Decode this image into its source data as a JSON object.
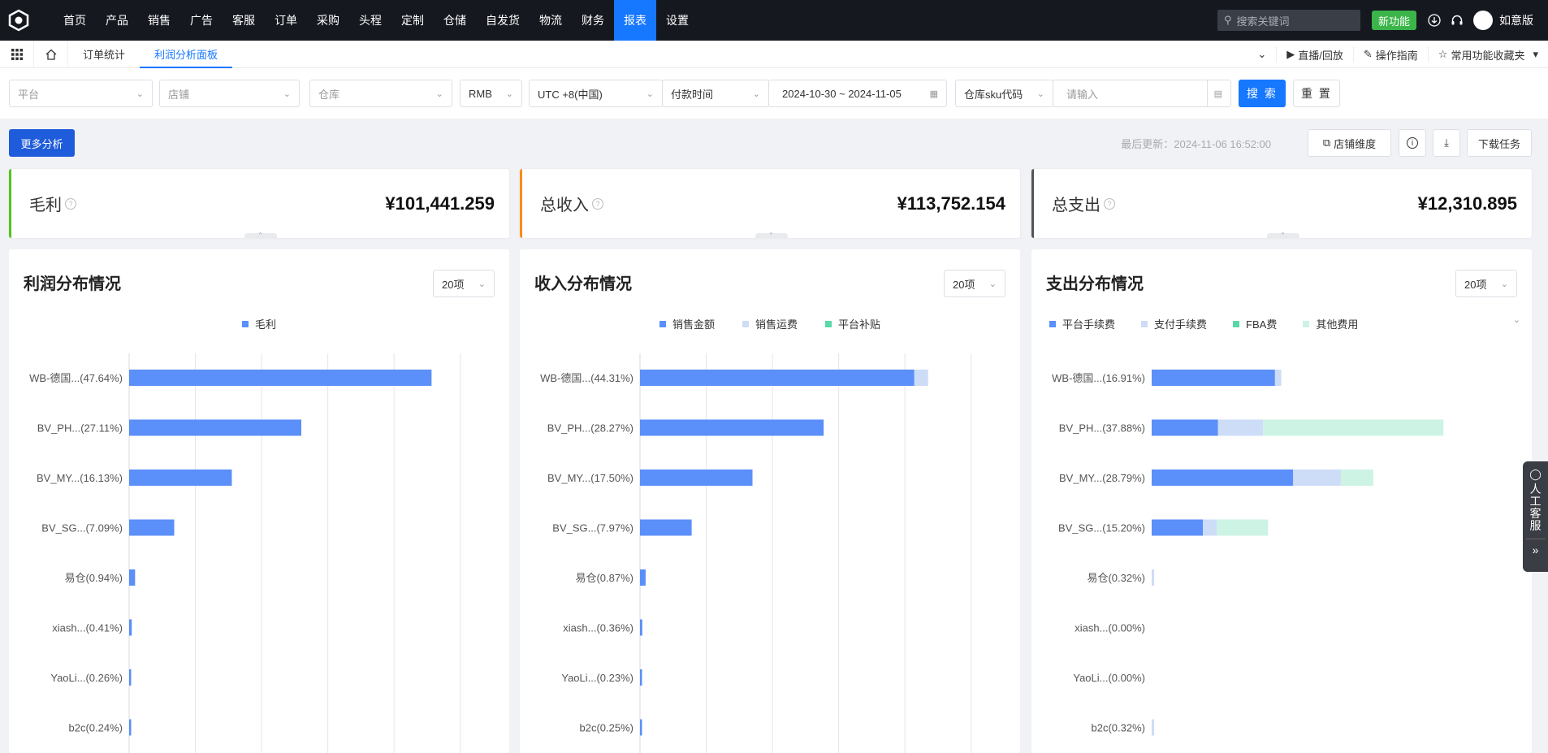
{
  "nav": {
    "items": [
      "首页",
      "产品",
      "销售",
      "广告",
      "客服",
      "订单",
      "采购",
      "头程",
      "定制",
      "仓储",
      "自发货",
      "物流",
      "财务",
      "报表",
      "设置"
    ],
    "active_index": 13,
    "search_placeholder": "搜索关键词",
    "new_feature": "新功能",
    "user_name": "如意版"
  },
  "tabs": {
    "items": [
      "订单统计",
      "利润分析面板"
    ],
    "active_index": 1,
    "right": [
      "直播/回放",
      "操作指南",
      "常用功能收藏夹"
    ]
  },
  "filters": {
    "platform": "平台",
    "store": "店铺",
    "warehouse": "仓库",
    "currency": "RMB",
    "timezone": "UTC +8(中国)",
    "time_type": "付款时间",
    "date_range": "2024-10-30 ~ 2024-11-05",
    "sku_type": "仓库sku代码",
    "sku_placeholder": "请输入",
    "search": "搜 索",
    "reset": "重 置"
  },
  "actions": {
    "more_analysis": "更多分析",
    "last_update": "最后更新：2024-11-06 16:52:00",
    "store_dimension": "店铺维度",
    "download_task": "下载任务"
  },
  "cards": [
    {
      "label": "毛利",
      "value": "¥101,441.259",
      "color": "#52c41a"
    },
    {
      "label": "总收入",
      "value": "¥113,752.154",
      "color": "#fa8c16"
    },
    {
      "label": "总支出",
      "value": "¥12,310.895",
      "color": "#555555"
    }
  ],
  "panels": [
    {
      "title": "利润分布情况",
      "select": "20项",
      "legend_align": "center"
    },
    {
      "title": "收入分布情况",
      "select": "20项",
      "legend_align": "center"
    },
    {
      "title": "支出分布情况",
      "select": "20项",
      "legend_align": "left"
    }
  ],
  "side_help": {
    "label": "人工客服"
  },
  "chart_data": [
    {
      "type": "bar",
      "orientation": "horizontal",
      "stacked": true,
      "categories": [
        "WB-德国...(47.64%)",
        "BV_PH...(27.11%)",
        "BV_MY...(16.13%)",
        "BV_SG...(7.09%)",
        "易仓(0.94%)",
        "xiash...(0.41%)",
        "YaoLi...(0.26%)",
        "b2c(0.24%)"
      ],
      "series": [
        {
          "name": "毛利",
          "color": "#5b8ff9",
          "values": [
            48300,
            27500,
            16400,
            7200,
            950,
            420,
            260,
            240
          ]
        }
      ],
      "xlim": [
        0,
        55000
      ],
      "grid": true
    },
    {
      "type": "bar",
      "orientation": "horizontal",
      "stacked": true,
      "categories": [
        "WB-德国...(44.31%)",
        "BV_PH...(28.27%)",
        "BV_MY...(17.50%)",
        "BV_SG...(7.97%)",
        "易仓(0.87%)",
        "xiash...(0.36%)",
        "YaoLi...(0.23%)",
        "b2c(0.25%)"
      ],
      "series": [
        {
          "name": "销售金额",
          "color": "#5b8ff9",
          "values": [
            47800,
            32000,
            19600,
            9000,
            980,
            400,
            260,
            280
          ]
        },
        {
          "name": "销售运费",
          "color": "#cddcf7",
          "values": [
            2400,
            0,
            0,
            0,
            0,
            0,
            0,
            0
          ]
        },
        {
          "name": "平台补贴",
          "color": "#5ad8a6",
          "values": [
            0,
            0,
            0,
            0,
            0,
            0,
            0,
            0
          ]
        }
      ],
      "xlim": [
        0,
        60000
      ],
      "grid": true
    },
    {
      "type": "bar",
      "orientation": "horizontal",
      "stacked": true,
      "categories": [
        "WB-德国...(16.91%)",
        "BV_PH...(37.88%)",
        "BV_MY...(28.79%)",
        "BV_SG...(15.20%)",
        "易仓(0.32%)",
        "xiash...(0.00%)",
        "YaoLi...(0.00%)",
        "b2c(0.32%)"
      ],
      "series": [
        {
          "name": "平台手续费",
          "color": "#5b8ff9",
          "values": [
            1970,
            1060,
            2260,
            820,
            0,
            0,
            0,
            0
          ]
        },
        {
          "name": "支付手续费",
          "color": "#cddcf7",
          "values": [
            100,
            720,
            760,
            220,
            40,
            0,
            0,
            40
          ]
        },
        {
          "name": "FBA费",
          "color": "#5ad8a6",
          "values": [
            0,
            0,
            0,
            0,
            0,
            0,
            0,
            0
          ]
        },
        {
          "name": "其他费用",
          "color": "#cdf3e4",
          "values": [
            0,
            2880,
            520,
            820,
            0,
            0,
            0,
            0
          ]
        }
      ],
      "xlim": [
        0,
        5500
      ],
      "grid": false
    }
  ]
}
